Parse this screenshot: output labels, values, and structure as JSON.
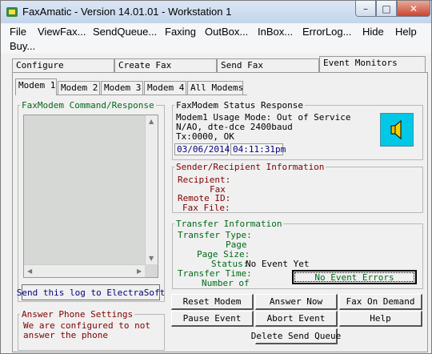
{
  "window": {
    "title": "FaxAmatic - Version 14.01.01 - Workstation 1"
  },
  "menu": [
    "File",
    "ViewFax...",
    "SendQueue...",
    "Faxing",
    "OutBox...",
    "InBox...",
    "ErrorLog...",
    "Hide",
    "Help",
    "Buy..."
  ],
  "top_tabs": [
    "Configure",
    "Create Fax",
    "Send Fax",
    "Event Monitors"
  ],
  "sub_tabs": [
    "Modem 1",
    "Modem 2",
    "Modem 3",
    "Modem 4",
    "All Modems"
  ],
  "command_panel": {
    "legend": "FaxModem Command/Response",
    "button": "Send this log to ElectraSoft"
  },
  "answer_panel": {
    "legend": "Answer Phone Settings",
    "line1": "We are configured to not",
    "line2": "answer the phone"
  },
  "status_panel": {
    "legend": "FaxModem Status Response",
    "line1": "Modem1 Usage Mode: Out of Service",
    "line2": "N/AO, dte-dce 2400baud",
    "line3": "Tx:0000,       OK",
    "date": "03/06/2014",
    "time": "04:11:31pm"
  },
  "sender_panel": {
    "legend": "Sender/Recipient Information",
    "recipient": "Recipient:",
    "fax": "Fax",
    "remote_id": "Remote ID:",
    "fax_file": "Fax File:"
  },
  "transfer_panel": {
    "legend": "Transfer Information",
    "transfer_type": "Transfer Type:",
    "page": "Page",
    "page_size": "Page Size:",
    "status_label": "Status:",
    "status_value": "No Event Yet",
    "transfer_time": "Transfer Time:",
    "number_of": "Number of",
    "errors_button": "No Event Errors"
  },
  "buttons": {
    "reset_modem": "Reset Modem",
    "answer_now": "Answer Now",
    "fax_on_demand": "Fax On Demand",
    "pause_event": "Pause Event",
    "abort_event": "Abort Event",
    "help": "Help",
    "delete_send_queue": "Delete Send Queue"
  },
  "colors": {
    "legend_green": "#006a1a",
    "text_maroon": "#800000",
    "text_navy": "#000080",
    "speaker_bg": "#00c8e6"
  },
  "icons": [
    "app-icon",
    "speaker-icon",
    "minimize-icon",
    "maximize-icon",
    "close-icon"
  ]
}
